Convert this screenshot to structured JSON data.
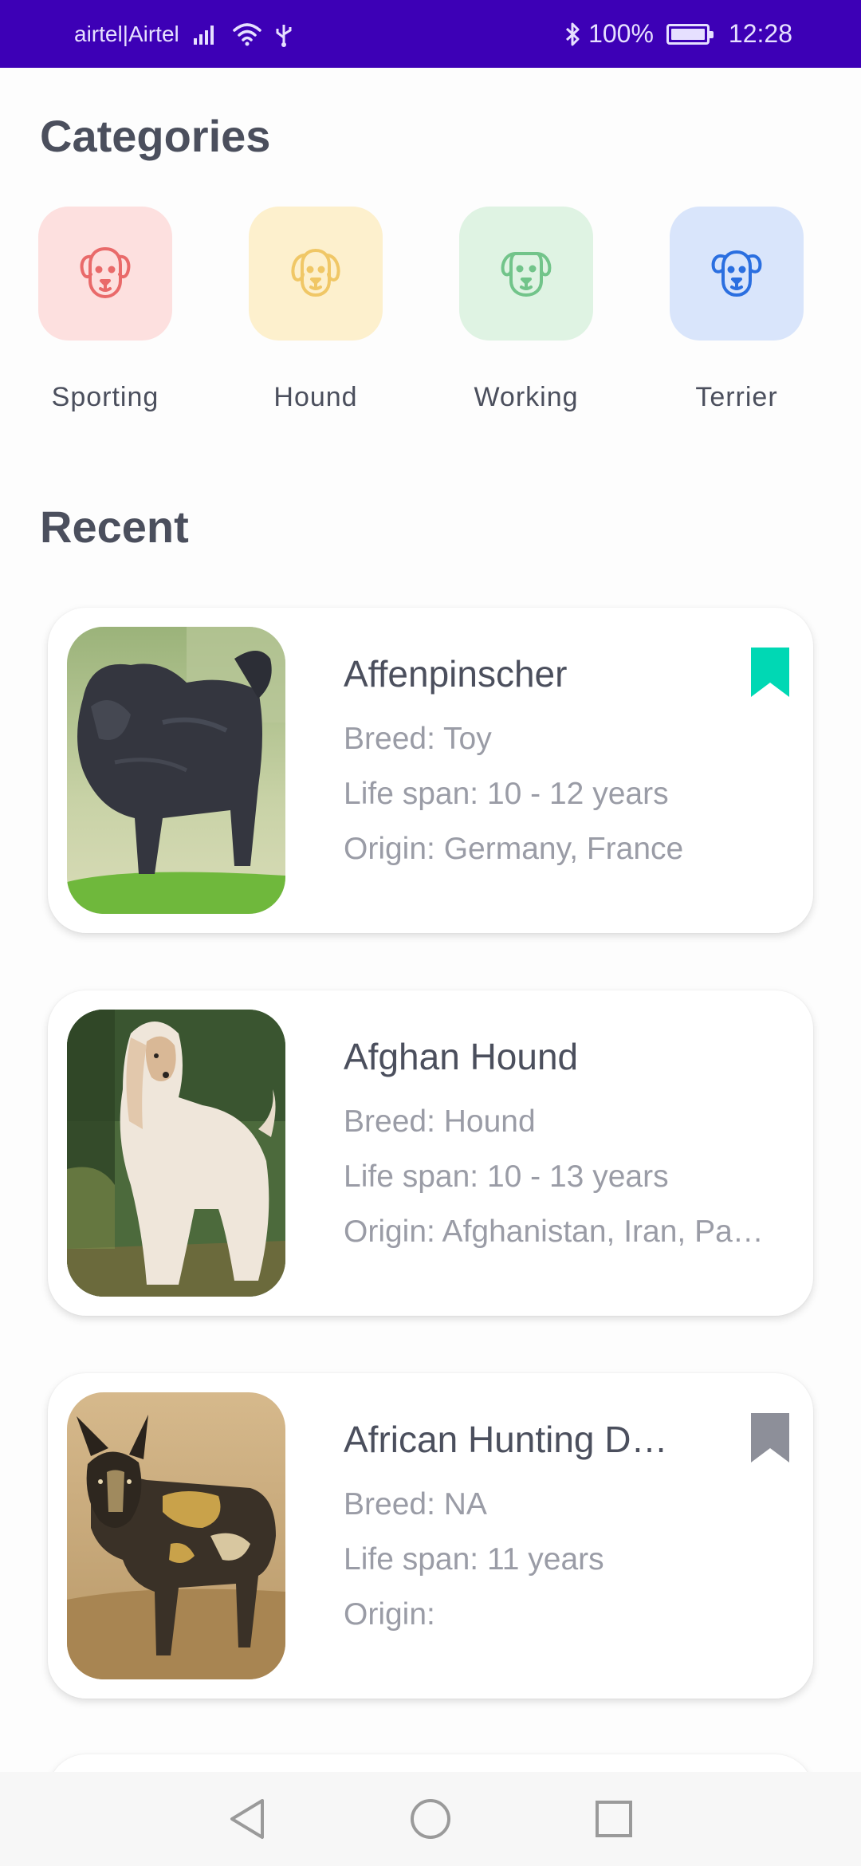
{
  "status_bar": {
    "carrier": "airtel|Airtel",
    "battery": "100%",
    "time": "12:28",
    "icons": [
      "signal-icon",
      "wifi-icon",
      "usb-icon",
      "bluetooth-icon",
      "battery-icon"
    ]
  },
  "categories": {
    "title": "Categories",
    "items": [
      {
        "label": "Sporting",
        "icon": "dog-face-icon",
        "tile_color": "#fde0df",
        "icon_color": "#e96a6a"
      },
      {
        "label": "Hound",
        "icon": "dog-face-icon",
        "tile_color": "#fdf0cd",
        "icon_color": "#f0c766"
      },
      {
        "label": "Working",
        "icon": "dog-face-icon",
        "tile_color": "#dff3e3",
        "icon_color": "#72c48a"
      },
      {
        "label": "Terrier",
        "icon": "dog-face-icon",
        "tile_color": "#d9e5fb",
        "icon_color": "#2b6fe0"
      }
    ]
  },
  "recent": {
    "title": "Recent",
    "cards": [
      {
        "name": "Affenpinscher",
        "breed": "Breed: Toy",
        "life_span": "Life span: 10 - 12 years",
        "origin": "Origin: Germany, France",
        "bookmarked": true,
        "bookmark_color": "#00d8b4"
      },
      {
        "name": "Afghan Hound",
        "breed": "Breed: Hound",
        "life_span": "Life span: 10 - 13 years",
        "origin": "Origin: Afghanistan, Iran, Pa…",
        "bookmarked": false
      },
      {
        "name": "African Hunting D…",
        "breed": "Breed: NA",
        "life_span": "Life span: 11 years",
        "origin": "Origin:",
        "bookmarked": false,
        "bookmark_color": "#8d8f99"
      }
    ]
  },
  "nav_bar": {
    "buttons": [
      "back-icon",
      "home-icon",
      "recents-icon"
    ]
  }
}
